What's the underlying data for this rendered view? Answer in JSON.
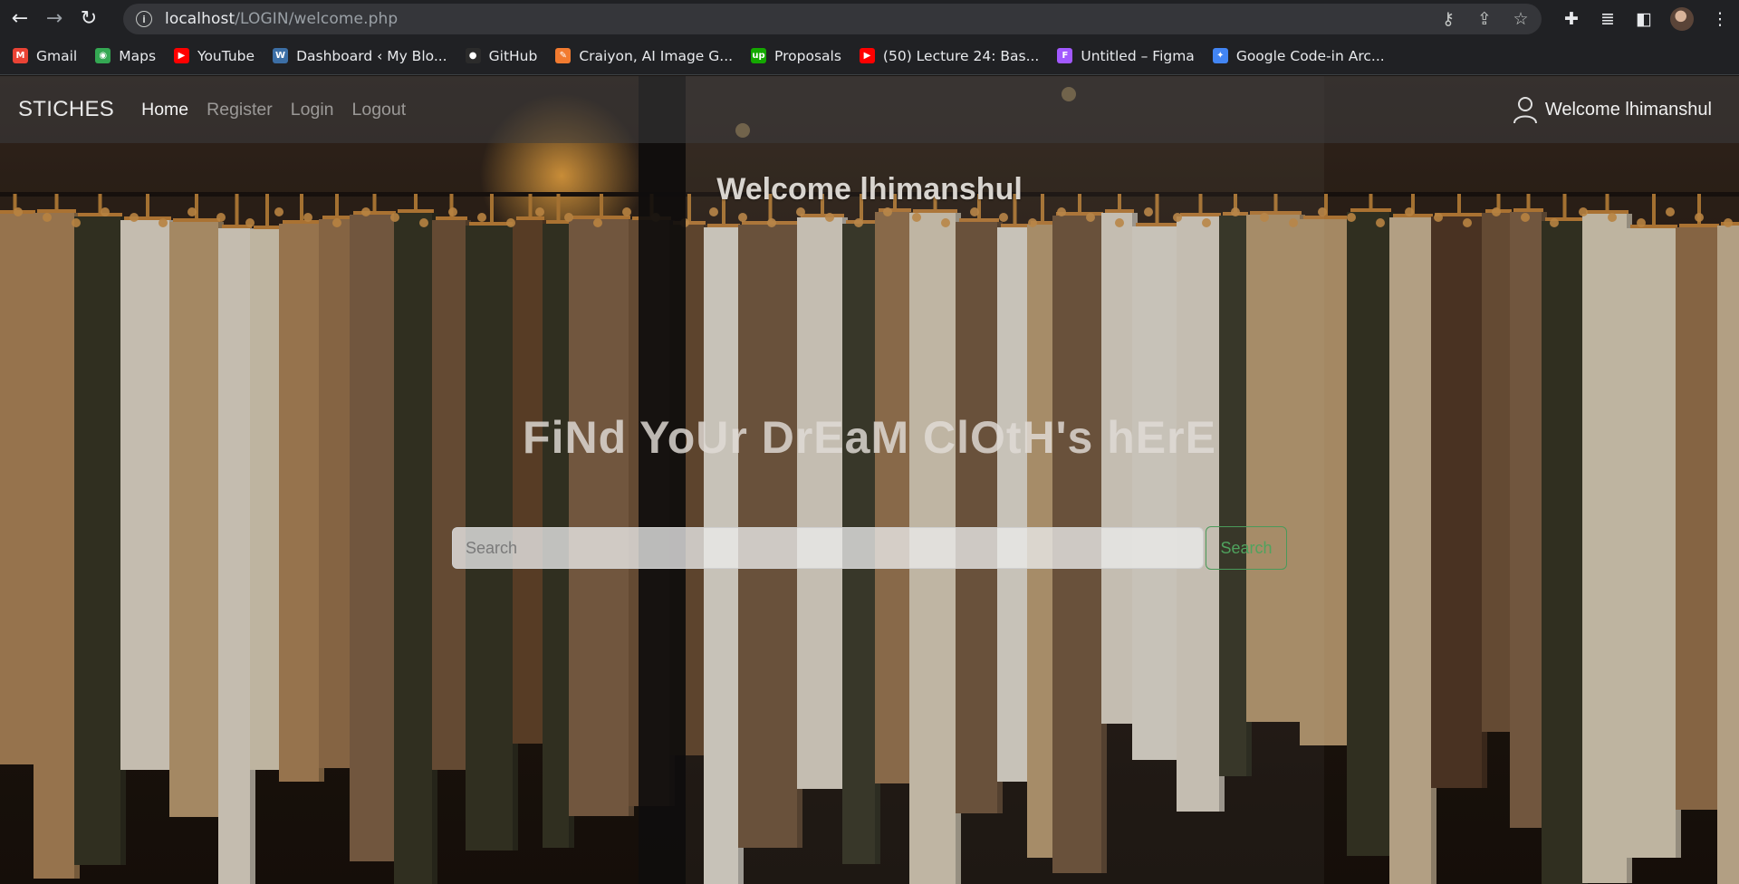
{
  "browser": {
    "url_host": "localhost",
    "url_path": "/LOGIN/welcome.php",
    "bookmarks": [
      {
        "label": "Gmail",
        "color": "#ea4335",
        "glyph": "M"
      },
      {
        "label": "Maps",
        "color": "#34a853",
        "glyph": "◉"
      },
      {
        "label": "YouTube",
        "color": "#ff0000",
        "glyph": "▶"
      },
      {
        "label": "Dashboard ‹ My Blo...",
        "color": "#3c6fa6",
        "glyph": "W"
      },
      {
        "label": "GitHub",
        "color": "#2b2b2b",
        "glyph": "●"
      },
      {
        "label": "Craiyon, AI Image G...",
        "color": "#f27b30",
        "glyph": "✎"
      },
      {
        "label": "Proposals",
        "color": "#14a800",
        "glyph": "up"
      },
      {
        "label": "(50) Lecture 24: Bas...",
        "color": "#ff0000",
        "glyph": "▶"
      },
      {
        "label": "Untitled – Figma",
        "color": "#a259ff",
        "glyph": "F"
      },
      {
        "label": "Google Code-in Arc...",
        "color": "#4285f4",
        "glyph": "✦"
      }
    ]
  },
  "site": {
    "brand": "STICHES",
    "nav": [
      "Home",
      "Register",
      "Login",
      "Logout"
    ],
    "welcome_nav": "Welcome lhimanshul",
    "welcome_title": "Welcome lhimanshul",
    "hero_text": "FiNd YoUr DrEaM ClOtH's hErE",
    "search_placeholder": "Search",
    "search_button": "Search"
  },
  "colors": {
    "accent_green": "#4fa35e",
    "navbar_bg": "rgba(60,60,62,0.55)"
  }
}
